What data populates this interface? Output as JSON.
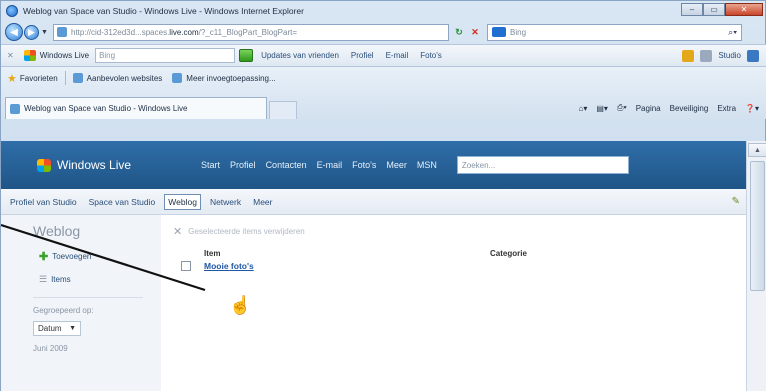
{
  "window": {
    "title": "Weblog van Space van Studio - Windows Live - Windows Internet Explorer",
    "controls": {
      "minimize": "–",
      "maximize": "▭",
      "close": "✕"
    }
  },
  "address_bar": {
    "url_prefix": "http://cid-312ed3d...spaces.",
    "url_host": "live.com",
    "url_suffix": "/?_c11_BlogPart_BlogPart=",
    "search_text": "Bing"
  },
  "live_toolbar": {
    "brand": "Windows Live",
    "search_text": "Bing",
    "links": [
      "Updates van vrienden",
      "Profiel",
      "E-mail",
      "Foto's"
    ],
    "right_label": "Studio"
  },
  "favorites_bar": {
    "label": "Favorieten",
    "items": [
      "Aanbevolen websites",
      "Meer invoegtoepassing..."
    ]
  },
  "tab": {
    "label": "Weblog van Space van Studio - Windows Live"
  },
  "command_bar": {
    "items": [
      "Pagina",
      "Beveiliging",
      "Extra"
    ]
  },
  "live_header": {
    "brand": "Windows Live",
    "nav": [
      "Start",
      "Profiel",
      "Contacten",
      "E-mail",
      "Foto's",
      "Meer",
      "MSN"
    ],
    "search_placeholder": "Zoeken..."
  },
  "space_nav": {
    "items": [
      "Profiel van Studio",
      "Space van Studio",
      "Weblog",
      "Netwerk",
      "Meer"
    ],
    "active": "Weblog"
  },
  "sidebar": {
    "heading": "Weblog",
    "add_label": "Toevoegen",
    "items_label": "Items",
    "grouped_label": "Gegroepeerd op:",
    "grouped_value": "Datum",
    "date": "Juni 2009"
  },
  "main": {
    "delete_label": "Geselecteerde items verwijderen",
    "col_item": "Item",
    "col_category": "Categorie",
    "entry_title": "Mooie foto's"
  },
  "colors": {
    "header_blue": "#1f5587",
    "link_blue": "#1f56a8"
  }
}
